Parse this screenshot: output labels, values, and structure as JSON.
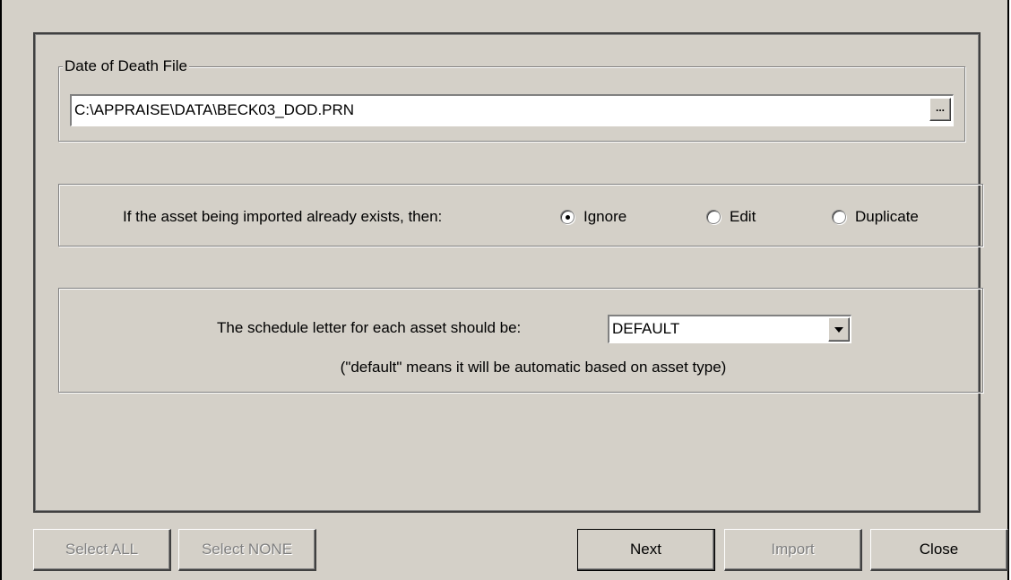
{
  "dod_group": {
    "legend": "Date of Death File",
    "path_value": "C:\\APPRAISE\\DATA\\BECK03_DOD.PRN",
    "browse_label": "..."
  },
  "existing_asset": {
    "prompt": "If the asset being imported already exists, then:",
    "options": [
      {
        "label": "Ignore",
        "checked": true
      },
      {
        "label": "Edit",
        "checked": false
      },
      {
        "label": "Duplicate",
        "checked": false
      }
    ]
  },
  "schedule": {
    "label": "The schedule letter for each asset should be:",
    "selected": "DEFAULT",
    "note": "(\"default\" means it will be automatic based on asset type)"
  },
  "buttons": {
    "select_all": "Select ALL",
    "select_none": "Select NONE",
    "next": "Next",
    "import": "Import",
    "close": "Close"
  }
}
